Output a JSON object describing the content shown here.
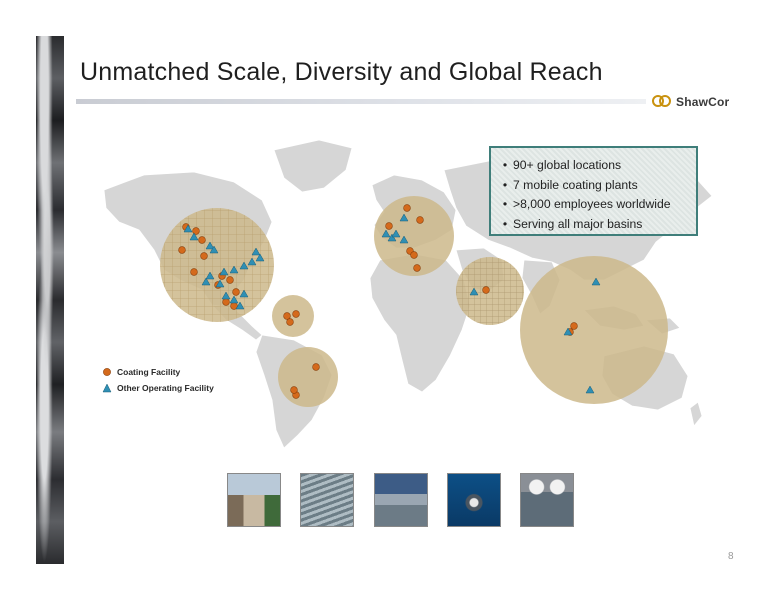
{
  "slide": {
    "title": "Unmatched Scale, Diversity and Global Reach",
    "logo_text": "ShawCor",
    "page_number": "8"
  },
  "highlights": [
    "90+ global locations",
    "7 mobile coating plants",
    ">8,000 employees worldwide",
    "Serving all major basins"
  ],
  "legend": {
    "coating": "Coating Facility",
    "other": "Other Operating Facility"
  },
  "colors": {
    "coating_marker": "#d46a1c",
    "other_marker": "#2f8fb4",
    "region_fill": "#cdb98b",
    "land": "#d6d6d6",
    "info_border": "#3f7e7a",
    "accent_gold": "#c9920f"
  },
  "photos": [
    "facility-building-photo",
    "pipe-coating-yard-photo",
    "operations-site-photo",
    "offshore-platform-photo",
    "field-workers-photo"
  ]
}
